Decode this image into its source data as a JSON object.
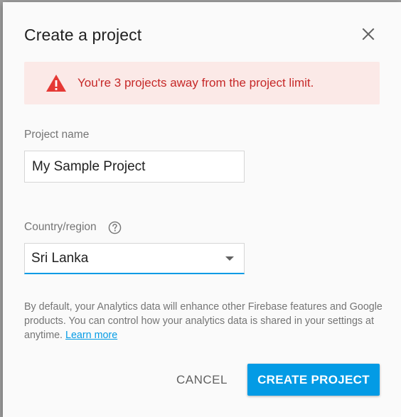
{
  "dialog": {
    "title": "Create a project",
    "close_icon": "close-icon"
  },
  "warning": {
    "icon": "warning-triangle-icon",
    "text": "You're 3 projects away from the project limit."
  },
  "project_name": {
    "label": "Project name",
    "value": "My Sample Project"
  },
  "country": {
    "label": "Country/region",
    "help_icon": "help-circle-icon",
    "value": "Sri Lanka"
  },
  "info": {
    "text": "By default, your Analytics data will enhance other Firebase features and Google products. You can control how your analytics data is shared in your settings at anytime.",
    "link": "Learn more"
  },
  "actions": {
    "cancel_label": "CANCEL",
    "create_label": "CREATE PROJECT"
  },
  "colors": {
    "accent": "#039be5",
    "warning_bg": "#fbe9e7",
    "warning_text": "#c62828",
    "warning_icon": "#e53935"
  }
}
